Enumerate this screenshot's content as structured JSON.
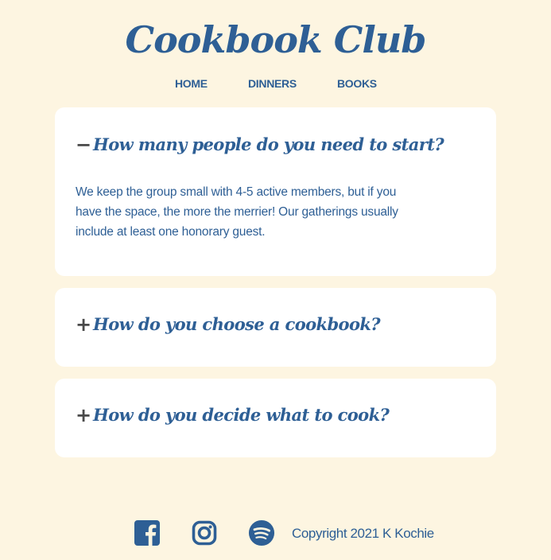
{
  "site": {
    "title": "Cookbook Club"
  },
  "nav": {
    "items": [
      {
        "label": "HOME"
      },
      {
        "label": "DINNERS"
      },
      {
        "label": "BOOKS"
      }
    ]
  },
  "faq": [
    {
      "toggle": "−",
      "question": "How many people do you need to start?",
      "answer": "We keep the group small with 4-5 active members, but if you have the space, the more the merrier! Our gatherings usually include at least one honorary guest.",
      "expanded": true
    },
    {
      "toggle": "+",
      "question": "How do you choose a cookbook?",
      "expanded": false
    },
    {
      "toggle": "+",
      "question": "How do you decide what to cook?",
      "expanded": false
    }
  ],
  "footer": {
    "icons": [
      "facebook-icon",
      "instagram-icon",
      "spotify-icon"
    ],
    "copyright": "Copyright 2021 K Kochie"
  },
  "colors": {
    "background": "#fdf5e1",
    "card": "#ffffff",
    "accent": "#2e5f95",
    "toggle": "#4a4a4a"
  }
}
